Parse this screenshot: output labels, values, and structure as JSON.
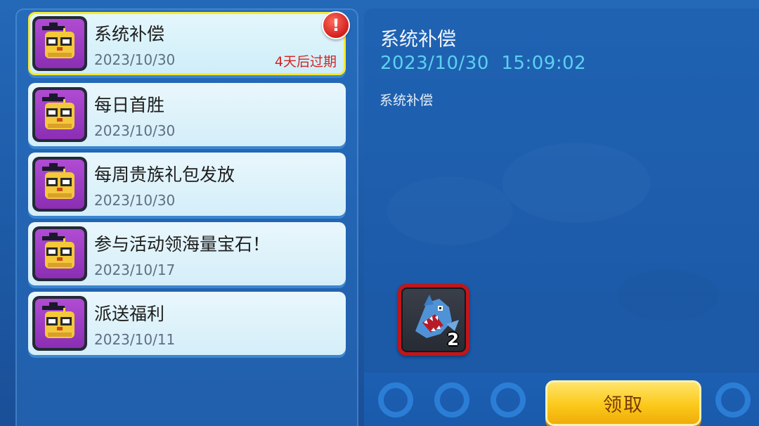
{
  "mail_list": [
    {
      "title": "系统补偿",
      "date": "2023/10/30",
      "expire": "4天后过期",
      "selected": true,
      "unread": true
    },
    {
      "title": "每日首胜",
      "date": "2023/10/30"
    },
    {
      "title": "每周贵族礼包发放",
      "date": "2023/10/30"
    },
    {
      "title": "参与活动领海量宝石！",
      "date": "2023/10/17"
    },
    {
      "title": "派送福利",
      "date": "2023/10/11"
    }
  ],
  "alert_badge": "!",
  "detail": {
    "title": "系统补偿",
    "datetime": "2023/10/30  15:09:02",
    "body": "系统补偿"
  },
  "reward": {
    "icon": "shark-icon",
    "count": "2"
  },
  "claim_button_label": "领取",
  "colors": {
    "accent_cyan": "#5bd1f0",
    "expire_red": "#d3251f",
    "selected_border": "#f7ea2f",
    "button_yellow": "#fbc91a"
  }
}
